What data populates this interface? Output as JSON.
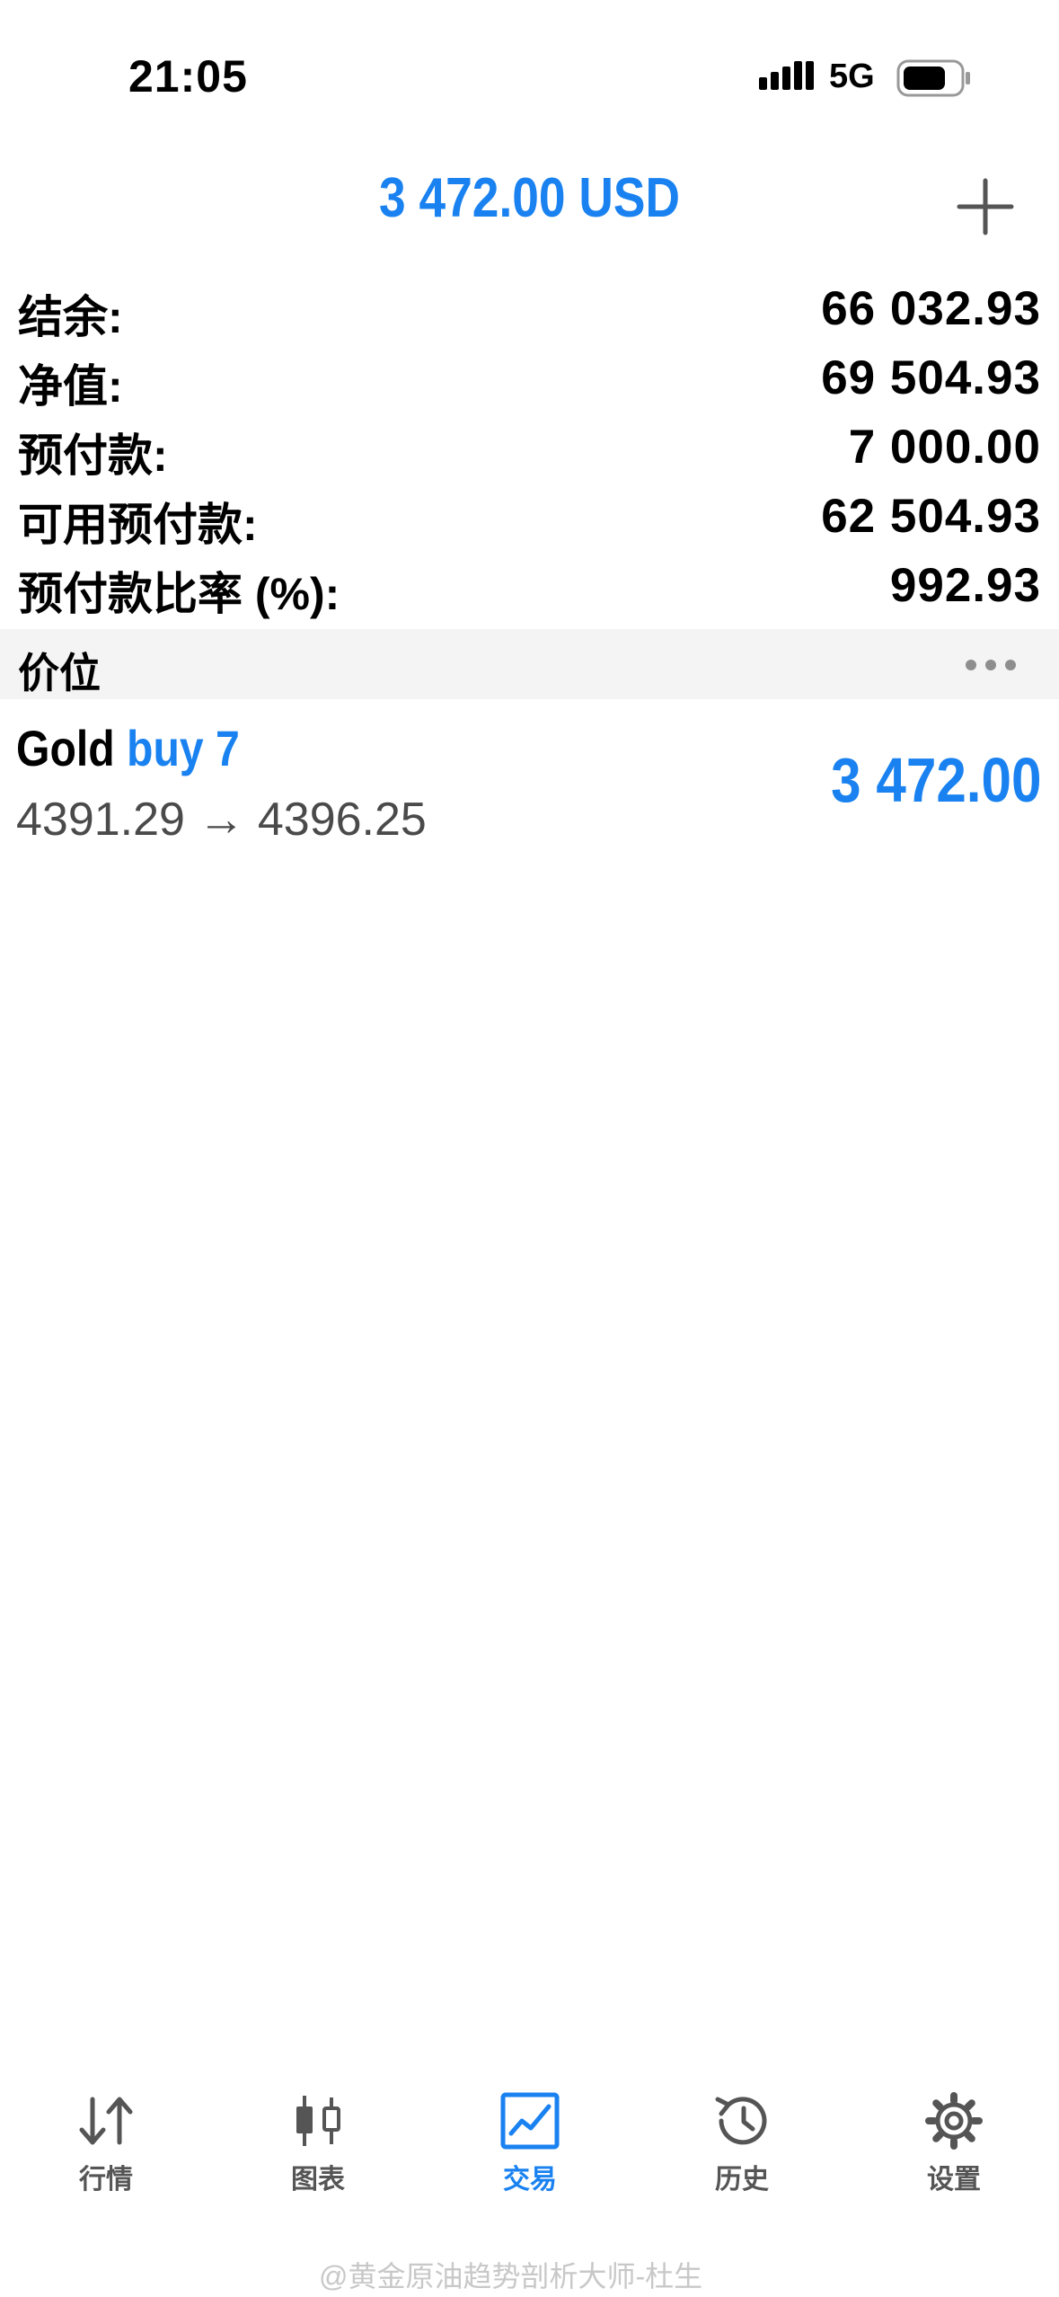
{
  "status_bar": {
    "time": "21:05",
    "network": "5G",
    "icons": [
      "signal-icon",
      "battery-icon"
    ]
  },
  "header": {
    "title": "3 472.00 USD",
    "add_icon": "plus-icon"
  },
  "summary": [
    {
      "label": "结余:",
      "value": "66 032.93"
    },
    {
      "label": "净值:",
      "value": "69 504.93"
    },
    {
      "label": "预付款:",
      "value": "7 000.00"
    },
    {
      "label": "可用预付款:",
      "value": "62 504.93"
    },
    {
      "label": "预付款比率 (%):",
      "value": "992.93"
    }
  ],
  "section": {
    "title": "价位",
    "more_icon": "ellipsis-icon"
  },
  "position": {
    "symbol": "Gold",
    "type": "buy 7",
    "prices": "4391.29 → 4396.25",
    "profit": "3 472.00"
  },
  "tabs": [
    {
      "label": "行情",
      "icon": "quotes-arrows-icon",
      "active": false
    },
    {
      "label": "图表",
      "icon": "candlestick-chart-icon",
      "active": false
    },
    {
      "label": "交易",
      "icon": "trade-line-chart-icon",
      "active": true
    },
    {
      "label": "历史",
      "icon": "history-clock-icon",
      "active": false
    },
    {
      "label": "设置",
      "icon": "gear-icon",
      "active": false
    }
  ],
  "watermark": "@黄金原油趋势剖析大师-杜生",
  "colors": {
    "accent": "#1a82f0",
    "section_bg": "#f4f4f4",
    "icon_gray": "#555555"
  }
}
